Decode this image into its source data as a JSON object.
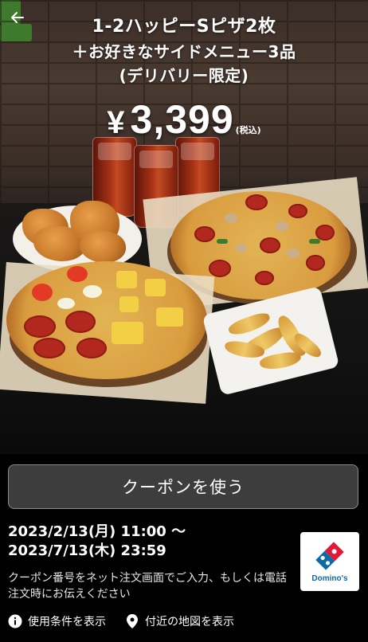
{
  "header": {
    "back_icon": "arrow-left-icon",
    "title_lines": [
      "1-2ハッピーSピザ2枚",
      "＋お好きなサイドメニュー3品",
      "(デリバリー限定)"
    ]
  },
  "price": {
    "currency": "¥",
    "amount": "3,399",
    "tax_note": "(税込)"
  },
  "coupon": {
    "use_button_label": "クーポンを使う",
    "valid_from": "2023/2/13(月) 11:00 ～",
    "valid_to": "2023/7/13(木) 23:59",
    "instructions": "クーポン番号をネット注文画面でご入力、もしくは電話注文時にお伝えください"
  },
  "brand": {
    "logo_text": "Domino's",
    "colors": {
      "blue": "#0b6aa8",
      "red": "#e31837"
    }
  },
  "links": {
    "terms_label": "使用条件を表示",
    "terms_icon": "info-icon",
    "map_label": "付近の地図を表示",
    "map_icon": "location-pin-icon"
  },
  "colors": {
    "panel_bg": "#000000",
    "button_bg": "#3d3d3d",
    "button_border": "#8a8a8a"
  }
}
